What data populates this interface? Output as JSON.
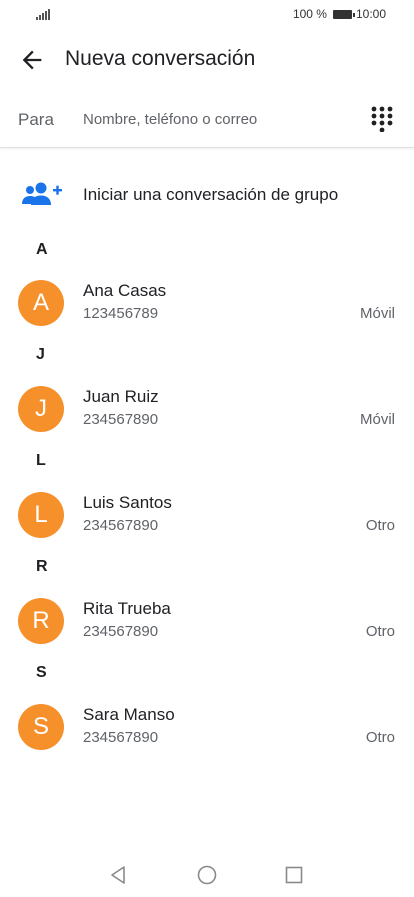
{
  "status_bar": {
    "battery_percent": "100 %",
    "time": "10:00"
  },
  "app_bar": {
    "title": "Nueva conversación",
    "back_icon": "arrow-back-icon"
  },
  "to_field": {
    "label": "Para",
    "placeholder": "Nombre, teléfono o correo",
    "value": "",
    "dialpad_icon": "dialpad-icon"
  },
  "group_action": {
    "label": "Iniciar una conversación de grupo",
    "icon": "group-add-icon"
  },
  "sections": [
    {
      "letter": "A",
      "contacts": [
        {
          "initial": "A",
          "name": "Ana Casas",
          "number": "123456789",
          "type": "Móvil"
        }
      ]
    },
    {
      "letter": "J",
      "contacts": [
        {
          "initial": "J",
          "name": "Juan Ruiz",
          "number": "234567890",
          "type": "Móvil"
        }
      ]
    },
    {
      "letter": "L",
      "contacts": [
        {
          "initial": "L",
          "name": "Luis Santos",
          "number": "234567890",
          "type": "Otro"
        }
      ]
    },
    {
      "letter": "R",
      "contacts": [
        {
          "initial": "R",
          "name": "Rita Trueba",
          "number": "234567890",
          "type": "Otro"
        }
      ]
    },
    {
      "letter": "S",
      "contacts": [
        {
          "initial": "S",
          "name": "Sara Manso",
          "number": "234567890",
          "type": "Otro"
        }
      ]
    }
  ],
  "colors": {
    "avatar": "#f6902b",
    "accent": "#1a73e8",
    "text_primary": "#202124",
    "text_secondary": "#5f6368"
  },
  "nav_bar": {
    "icons": [
      "back-triangle-icon",
      "home-circle-icon",
      "recents-square-icon"
    ]
  }
}
